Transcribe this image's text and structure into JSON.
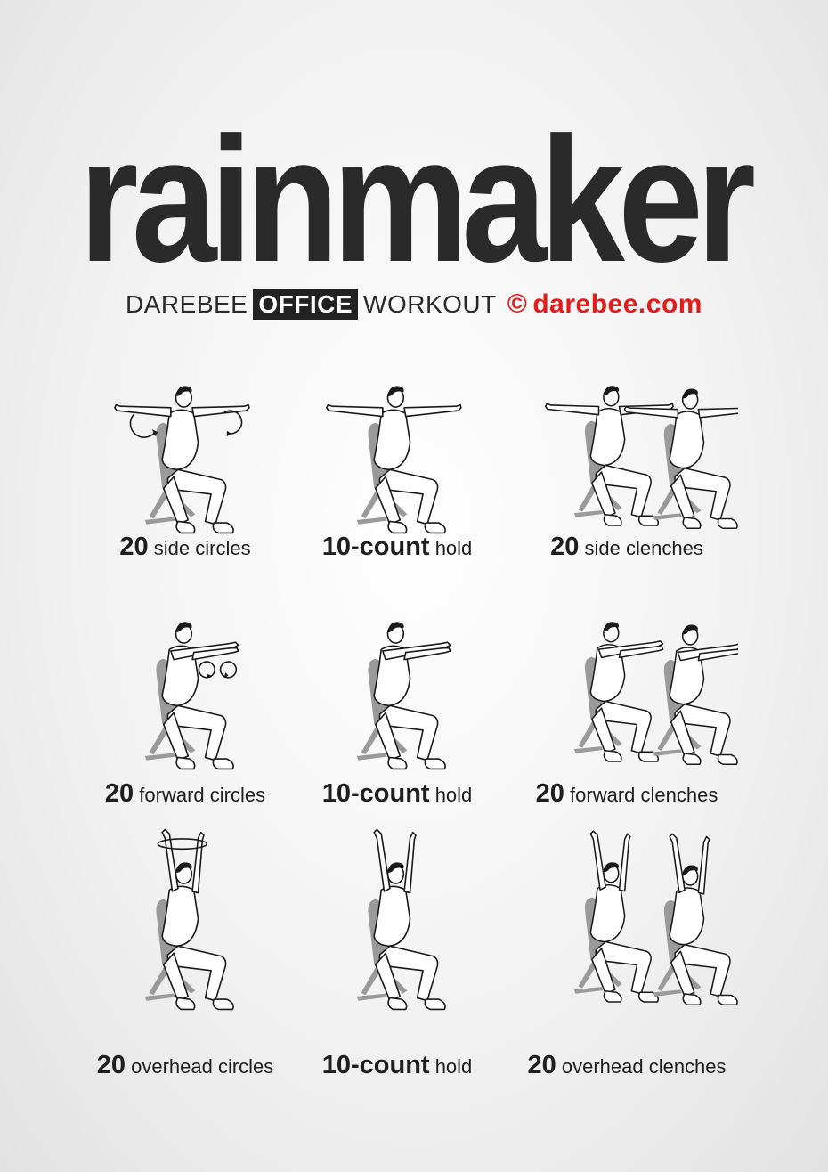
{
  "title": "rainmaker",
  "subtitle": {
    "prefix": "DAREBEE",
    "box": "OFFICE",
    "suffix": "WORKOUT",
    "copyright": "©",
    "site": "darebee.com"
  },
  "colors": {
    "accent": "#e31b1b",
    "text": "#2a2a2a"
  },
  "exercises": [
    {
      "count": "20",
      "name": "side circles",
      "pose": "side",
      "figures": 1,
      "arrows": true
    },
    {
      "count": "10-count",
      "name": "hold",
      "pose": "side",
      "figures": 1,
      "arrows": false
    },
    {
      "count": "20",
      "name": "side clenches",
      "pose": "side",
      "figures": 2,
      "arrows": false
    },
    {
      "count": "20",
      "name": "forward circles",
      "pose": "forward",
      "figures": 1,
      "arrows": true
    },
    {
      "count": "10-count",
      "name": "hold",
      "pose": "forward",
      "figures": 1,
      "arrows": false
    },
    {
      "count": "20",
      "name": "forward clenches",
      "pose": "forward",
      "figures": 2,
      "arrows": false
    },
    {
      "count": "20",
      "name": "overhead circles",
      "pose": "overhead",
      "figures": 1,
      "arrows": true
    },
    {
      "count": "10-count",
      "name": "hold",
      "pose": "overhead",
      "figures": 1,
      "arrows": false
    },
    {
      "count": "20",
      "name": "overhead clenches",
      "pose": "overhead",
      "figures": 2,
      "arrows": false
    }
  ]
}
